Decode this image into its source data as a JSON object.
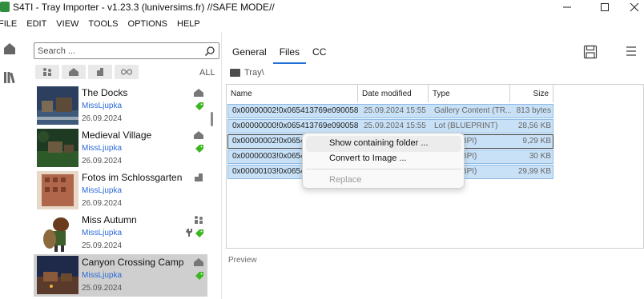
{
  "window": {
    "title": "S4TI - Tray Importer - v1.23.3  (luniversims.fr) //SAFE MODE//",
    "icons": {
      "app": "s4ti-app-icon",
      "minimize": "minimize-icon",
      "maximize": "maximize-icon",
      "close": "close-icon"
    }
  },
  "menu": [
    "FILE",
    "EDIT",
    "VIEW",
    "TOOLS",
    "OPTIONS",
    "HELP"
  ],
  "rail": {
    "icons": [
      "home-icon",
      "library-icon"
    ]
  },
  "library": {
    "search_placeholder": "Search ...",
    "filters": [
      "sims-filter-icon",
      "households-filter-icon",
      "rooms-filter-icon",
      "infinity-filter-icon"
    ],
    "all_label": "ALL",
    "items": [
      {
        "name": "The Docks",
        "author": "MissLjupka",
        "date": "26.09.2024",
        "type_icon": "lot-icon",
        "tagged": true,
        "selected": false
      },
      {
        "name": "Medieval Village",
        "author": "MissLjupka",
        "date": "26.09.2024",
        "type_icon": "lot-icon",
        "tagged": true,
        "selected": false
      },
      {
        "name": "Fotos im Schlossgarten",
        "author": "MissLjupka",
        "date": "26.09.2024",
        "type_icon": "room-icon",
        "tagged": false,
        "selected": false
      },
      {
        "name": "Miss Autumn",
        "author": "MissLjupka",
        "date": "25.09.2024",
        "type_icon": "household-icon",
        "tagged": true,
        "selected": false
      },
      {
        "name": "Canyon Crossing Camp",
        "author": "MissLjupka",
        "date": "25.09.2024",
        "type_icon": "lot-icon",
        "tagged": true,
        "selected": true
      }
    ]
  },
  "tabs": [
    "General",
    "Files",
    "CC"
  ],
  "active_tab": "Files",
  "breadcrumb": "Tray\\",
  "files": {
    "columns": [
      "Name",
      "Date modified",
      "Type",
      "Size"
    ],
    "rows": [
      {
        "name": "0x00000002!0x065413769e090058",
        "date": "25.09.2024 15:55",
        "type": "Gallery Content (TR...",
        "size": "813 bytes"
      },
      {
        "name": "0x00000000!0x065413769e090058",
        "date": "25.09.2024 15:55",
        "type": "Lot (BLUEPRINT)",
        "size": "28,56 KB"
      },
      {
        "name": "0x00000002!0x06541",
        "date": "",
        "type": "Image (BPI)",
        "size": "9,29 KB"
      },
      {
        "name": "0x00000003!0x06541",
        "date": "",
        "type": "Image (BPI)",
        "size": "30 KB"
      },
      {
        "name": "0x00000103!0x06541",
        "date": "",
        "type": "Image (BPI)",
        "size": "29,99 KB"
      }
    ]
  },
  "context_menu": {
    "items": [
      {
        "label": "Show containing folder ...",
        "enabled": true
      },
      {
        "label": "Convert to Image ...",
        "enabled": true
      },
      {
        "label": "Replace",
        "enabled": false
      }
    ]
  },
  "preview_label": "Preview",
  "colors": {
    "accent": "#1f6fd6",
    "author": "#2a6ad8",
    "tag": "#3cb521",
    "selection": "#c8e1f7"
  }
}
